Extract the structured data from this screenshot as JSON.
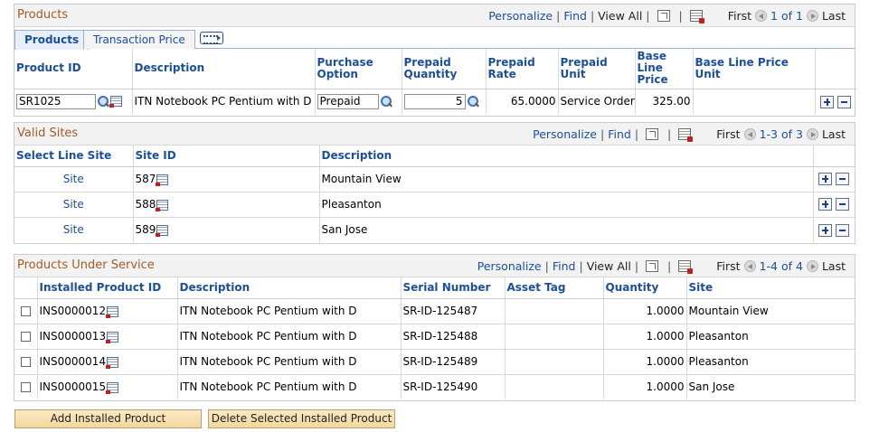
{
  "products": {
    "title": "Products",
    "nav": {
      "personalize": "Personalize",
      "find": "Find",
      "view_all": "View All",
      "first": "First",
      "range": "1 of 1",
      "last": "Last"
    },
    "tabs": [
      {
        "label": "Products"
      },
      {
        "label": "Transaction Price"
      }
    ],
    "columns": [
      "Product ID",
      "Description",
      "Purchase Option",
      "Prepaid Quantity",
      "Prepaid Rate",
      "Prepaid Unit",
      "Base Line Price",
      "Base Line Price Unit"
    ],
    "row": {
      "product_id": "SR1025",
      "description": "ITN Notebook PC Pentium with D",
      "purchase_option": "Prepaid",
      "prepaid_quantity": "5",
      "prepaid_rate": "65.0000",
      "prepaid_unit": "Service Order",
      "base_line_price": "325.00",
      "base_line_price_unit": ""
    }
  },
  "valid_sites": {
    "title": "Valid Sites",
    "nav": {
      "personalize": "Personalize",
      "find": "Find",
      "first": "First",
      "range": "1-3 of 3",
      "last": "Last"
    },
    "columns": [
      "Select Line Site",
      "Site ID",
      "Description"
    ],
    "rows": [
      {
        "select": "Site",
        "site_id": "587",
        "description": "Mountain View"
      },
      {
        "select": "Site",
        "site_id": "588",
        "description": "Pleasanton"
      },
      {
        "select": "Site",
        "site_id": "589",
        "description": "San Jose"
      }
    ]
  },
  "products_under_service": {
    "title": "Products Under Service",
    "nav": {
      "personalize": "Personalize",
      "find": "Find",
      "view_all": "View All",
      "first": "First",
      "range": "1-4 of 4",
      "last": "Last"
    },
    "columns": [
      "Installed Product ID",
      "Description",
      "Serial Number",
      "Asset Tag",
      "Quantity",
      "Site"
    ],
    "rows": [
      {
        "installed_id": "INS0000012",
        "description": "ITN Notebook PC Pentium with D",
        "serial": "SR-ID-125487",
        "asset_tag": "",
        "quantity": "1.0000",
        "site": "Mountain View"
      },
      {
        "installed_id": "INS0000013",
        "description": "ITN Notebook PC Pentium with D",
        "serial": "SR-ID-125488",
        "asset_tag": "",
        "quantity": "1.0000",
        "site": "Pleasanton"
      },
      {
        "installed_id": "INS0000014",
        "description": "ITN Notebook PC Pentium with D",
        "serial": "SR-ID-125489",
        "asset_tag": "",
        "quantity": "1.0000",
        "site": "Pleasanton"
      },
      {
        "installed_id": "INS0000015",
        "description": "ITN Notebook PC Pentium with D",
        "serial": "SR-ID-125490",
        "asset_tag": "",
        "quantity": "1.0000",
        "site": "San Jose"
      }
    ]
  },
  "buttons": {
    "add_installed": "Add Installed Product",
    "delete_selected": "Delete Selected Installed Product"
  },
  "colors": {
    "title": "#a55b25",
    "link": "#1b4f9c",
    "header_bg": "#f2f2f2",
    "button_bg": "#f3d79c"
  }
}
